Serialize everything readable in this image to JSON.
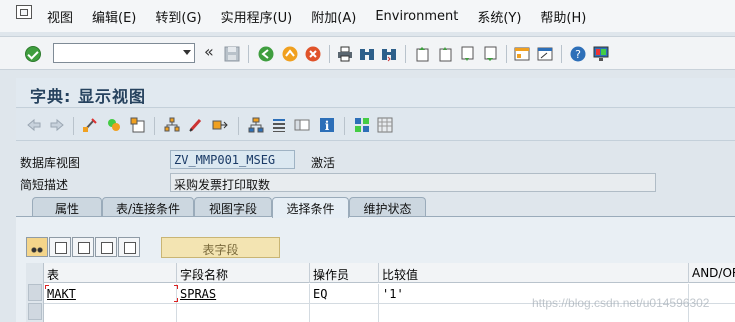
{
  "menu": {
    "items": [
      {
        "label": "视图"
      },
      {
        "label": "编辑(E)"
      },
      {
        "label": "转到(G)"
      },
      {
        "label": "实用程序(U)"
      },
      {
        "label": "附加(A)"
      },
      {
        "label": "Environment"
      },
      {
        "label": "系统(Y)"
      },
      {
        "label": "帮助(H)"
      }
    ]
  },
  "std_toolbar": {
    "command_value": "",
    "chevron": "«"
  },
  "title": "字典: 显示视图",
  "fields": {
    "view_label": "数据库视图",
    "view_value": "ZV_MMP001_MSEG",
    "view_status": "激活",
    "desc_label": "简短描述",
    "desc_value": "采购发票打印取数"
  },
  "tabs": [
    {
      "label": "属性",
      "active": false
    },
    {
      "label": "表/连接条件",
      "active": false
    },
    {
      "label": "视图字段",
      "active": false
    },
    {
      "label": "选择条件",
      "active": true
    },
    {
      "label": "维护状态",
      "active": false
    }
  ],
  "table_toolbar": {
    "table_field_button": "表字段"
  },
  "grid": {
    "headers": [
      "表",
      "字段名称",
      "操作员",
      "比较值",
      "AND/OR"
    ],
    "rows": [
      {
        "table": "MAKT",
        "field": "SPRAS",
        "op": "EQ",
        "value": "'1'",
        "andor": ""
      }
    ]
  },
  "watermark": "https://blog.csdn.net/u014596302",
  "colors": {
    "title": "#26425e",
    "active_tab": "#e6eef5",
    "table_field_button": "#f3e4b2"
  }
}
